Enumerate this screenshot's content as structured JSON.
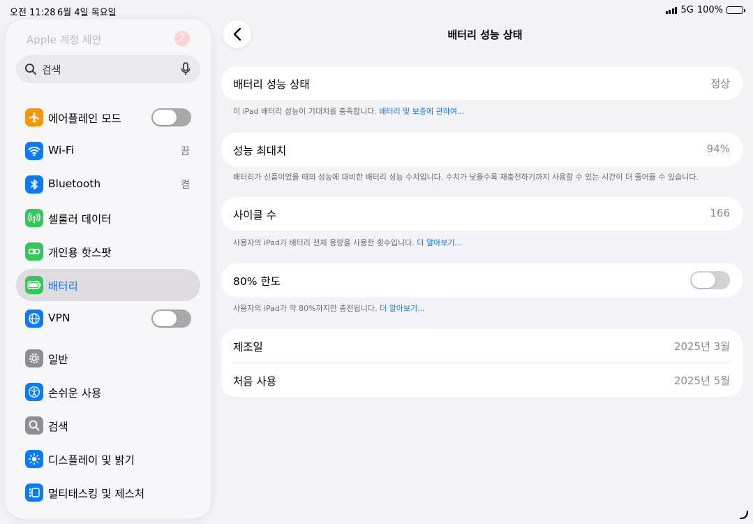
{
  "status_bar": {
    "time": "오전 11:28",
    "date": "6월 4일 목요일",
    "network": "5G",
    "battery": "100%"
  },
  "sidebar": {
    "apple_account": "Apple 계정 제안",
    "apple_badge": "2",
    "search_placeholder": "검색",
    "items": [
      {
        "label": "에어플레인 모드",
        "icon": "airplane-icon",
        "color": "#ff9500",
        "toggle": "off"
      },
      {
        "label": "Wi-Fi",
        "icon": "wifi-icon",
        "color": "#0a7aff",
        "value": "끔"
      },
      {
        "label": "Bluetooth",
        "icon": "bluetooth-icon",
        "color": "#0a7aff",
        "value": "켬"
      },
      {
        "label": "셀룰러 데이터",
        "icon": "antenna-icon",
        "color": "#34c759"
      },
      {
        "label": "개인용 핫스팟",
        "icon": "link-icon",
        "color": "#34c759"
      },
      {
        "label": "배터리",
        "icon": "battery-icon",
        "color": "#34c759",
        "selected": true
      },
      {
        "label": "VPN",
        "icon": "globe-icon",
        "color": "#0a7aff",
        "toggle": "off"
      },
      {
        "label": "일반",
        "icon": "gear-icon",
        "color": "#8e8e93"
      },
      {
        "label": "손쉬운 사용",
        "icon": "accessibility-icon",
        "color": "#0a7aff"
      },
      {
        "label": "검색",
        "icon": "search-icon",
        "color": "#8e8e93"
      },
      {
        "label": "디스플레이 및 밝기",
        "icon": "sun-icon",
        "color": "#0a7aff"
      },
      {
        "label": "멀티태스킹 및 제스처",
        "icon": "multitask-icon",
        "color": "#0a7aff"
      }
    ]
  },
  "main": {
    "title": "배터리 성능 상태",
    "health": {
      "label": "배터리 성능 상태",
      "value": "정상",
      "note": "이 iPad 배터리 성능이 기대치를 충족합니다. ",
      "link": "배터리 및 보증에 관하여..."
    },
    "max_capacity": {
      "label": "성능 최대치",
      "value": "94%",
      "note": "배터리가 신품이었을 때의 성능에 대비한 배터리 성능 수치입니다. 수치가 낮을수록 재충전하기까지 사용할 수 있는 시간이 더 줄어들 수 있습니다."
    },
    "cycle_count": {
      "label": "사이클 수",
      "value": "166",
      "note": "사용자의 iPad가 배터리 전체 용량을 사용한 횟수입니다. ",
      "link": "더 알아보기..."
    },
    "limit": {
      "label": "80% 한도",
      "toggle": "off",
      "note": "사용자의 iPad가 약 80%까지만 충전됩니다. ",
      "link": "더 알아보기..."
    },
    "manufacture": {
      "label": "제조일",
      "value": "2025년 3월"
    },
    "first_use": {
      "label": "처음 사용",
      "value": "2025년 5월"
    }
  }
}
